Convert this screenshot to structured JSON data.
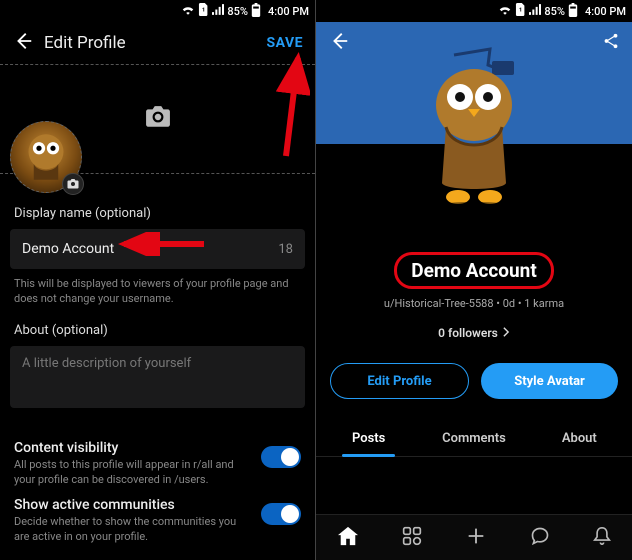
{
  "status": {
    "battery_pct": "85%",
    "time": "4:00 PM"
  },
  "left": {
    "header": {
      "title": "Edit Profile",
      "save": "SAVE"
    },
    "display_name": {
      "label": "Display name (optional)",
      "value": "Demo Account",
      "remaining": "18",
      "helper": "This will be displayed to viewers of your profile page and does not change your username."
    },
    "about": {
      "label": "About (optional)",
      "placeholder": "A little description of yourself"
    },
    "content_visibility": {
      "title": "Content visibility",
      "sub": "All posts to this profile will appear in r/all and your profile can be discovered in /users.",
      "on": true
    },
    "show_active": {
      "title": "Show active communities",
      "sub": "Decide whether to show the communities you are active in on your profile.",
      "on": true
    }
  },
  "right": {
    "display_name": "Demo Account",
    "subline": "u/Historical-Tree-5588 • 0d • 1 karma",
    "followers": "0 followers",
    "buttons": {
      "edit": "Edit Profile",
      "style": "Style Avatar"
    },
    "tabs": {
      "posts": "Posts",
      "comments": "Comments",
      "about": "About"
    }
  }
}
